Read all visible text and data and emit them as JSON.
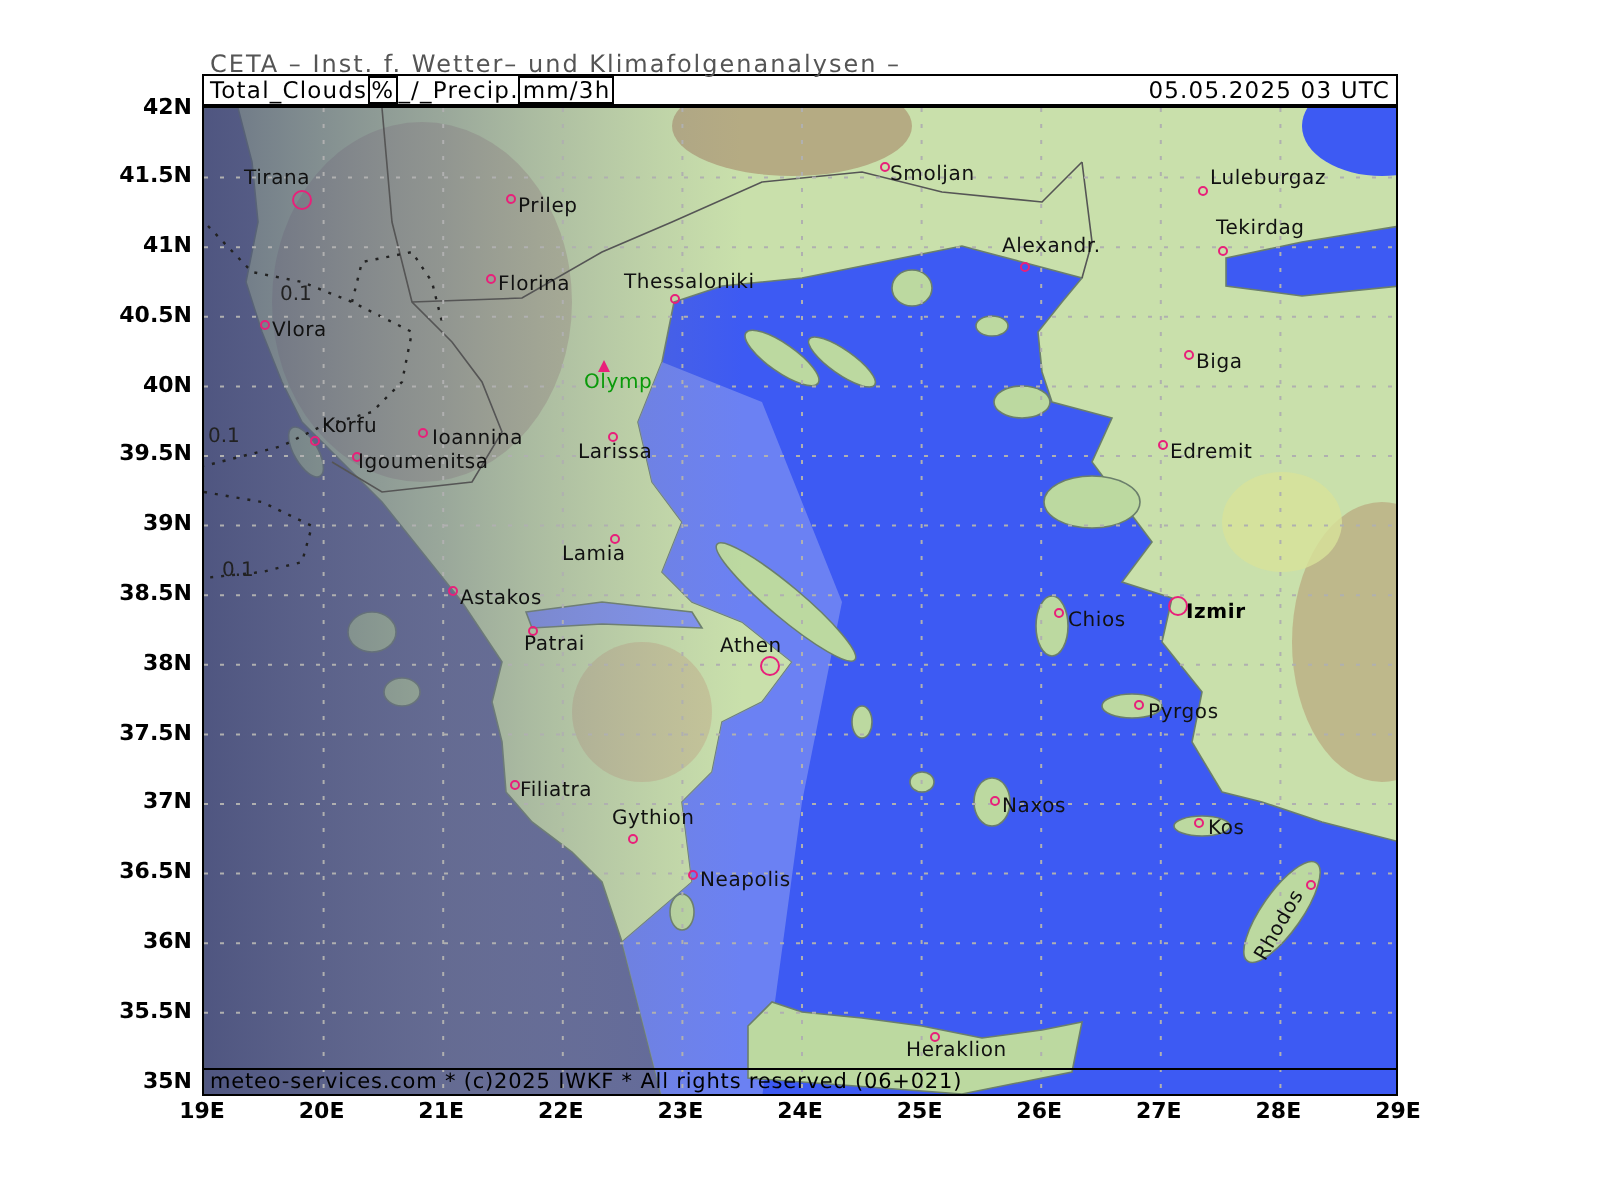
{
  "header": {
    "title": "CETA – Inst. f. Wetter– und Klimafolgenanalysen –"
  },
  "map_title": {
    "parts": [
      {
        "text": "Total_Clouds",
        "kind": "plain"
      },
      {
        "text": "%",
        "kind": "boxed"
      },
      {
        "text": "_/_Precip.",
        "kind": "plain"
      },
      {
        "text": "mm/3h",
        "kind": "boxed"
      }
    ],
    "time": "05.05.2025 03 UTC"
  },
  "map": {
    "places": [
      {
        "name": "Tirana",
        "kind": "city"
      },
      {
        "name": "Prilep",
        "kind": "town"
      },
      {
        "name": "Florina",
        "kind": "town"
      },
      {
        "name": "Thessaloniki",
        "kind": "town"
      },
      {
        "name": "Olymp",
        "kind": "peak"
      },
      {
        "name": "Vlora",
        "kind": "town"
      },
      {
        "name": "Korfu",
        "kind": "town"
      },
      {
        "name": "Ioannina",
        "kind": "town"
      },
      {
        "name": "Larissa",
        "kind": "town"
      },
      {
        "name": "Igoumenitsa",
        "kind": "town"
      },
      {
        "name": "Lamia",
        "kind": "town"
      },
      {
        "name": "Astakos",
        "kind": "town"
      },
      {
        "name": "Patrai",
        "kind": "town"
      },
      {
        "name": "Athen",
        "kind": "city"
      },
      {
        "name": "Filiatra",
        "kind": "town"
      },
      {
        "name": "Gythion",
        "kind": "town"
      },
      {
        "name": "Neapolis",
        "kind": "town"
      },
      {
        "name": "Smoljan",
        "kind": "town"
      },
      {
        "name": "Alexandr.",
        "kind": "town"
      },
      {
        "name": "Luleburgaz",
        "kind": "town"
      },
      {
        "name": "Tekirdag",
        "kind": "town"
      },
      {
        "name": "Biga",
        "kind": "town"
      },
      {
        "name": "Edremit",
        "kind": "town"
      },
      {
        "name": "Chios",
        "kind": "town"
      },
      {
        "name": "Izmir",
        "kind": "city"
      },
      {
        "name": "Pyrgos",
        "kind": "town"
      },
      {
        "name": "Naxos",
        "kind": "town"
      },
      {
        "name": "Kos",
        "kind": "town"
      },
      {
        "name": "Rhodos",
        "kind": "town"
      },
      {
        "name": "Heraklion",
        "kind": "town"
      }
    ],
    "contour_labels": [
      "0.1",
      "0.1",
      "0.1"
    ],
    "footer": "meteo-services.com * (c)2025 IWKF * All rights reserved (06+021)"
  },
  "axes": {
    "latitude_labels": [
      "42N",
      "41.5N",
      "41N",
      "40.5N",
      "40N",
      "39.5N",
      "39N",
      "38.5N",
      "38N",
      "37.5N",
      "37N",
      "36.5N",
      "36N",
      "35.5N",
      "35N"
    ],
    "longitude_labels": [
      "19E",
      "20E",
      "21E",
      "22E",
      "23E",
      "24E",
      "25E",
      "26E",
      "27E",
      "28E",
      "29E"
    ]
  }
}
